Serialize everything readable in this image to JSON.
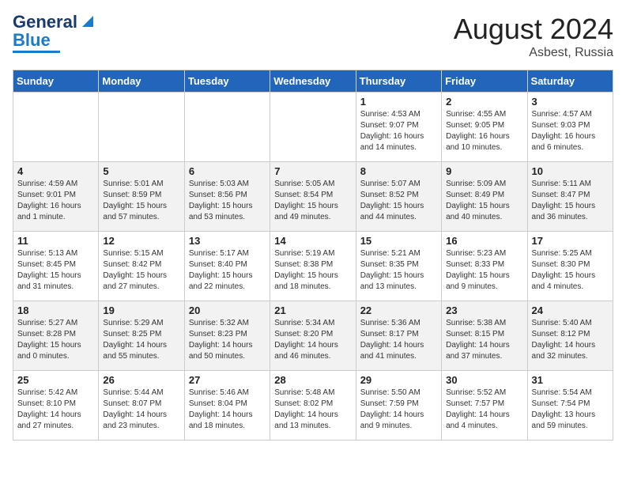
{
  "header": {
    "logo_line1": "General",
    "logo_line2": "Blue",
    "month_year": "August 2024",
    "location": "Asbest, Russia"
  },
  "days_of_week": [
    "Sunday",
    "Monday",
    "Tuesday",
    "Wednesday",
    "Thursday",
    "Friday",
    "Saturday"
  ],
  "weeks": [
    [
      {
        "day": "",
        "info": ""
      },
      {
        "day": "",
        "info": ""
      },
      {
        "day": "",
        "info": ""
      },
      {
        "day": "",
        "info": ""
      },
      {
        "day": "1",
        "info": "Sunrise: 4:53 AM\nSunset: 9:07 PM\nDaylight: 16 hours\nand 14 minutes."
      },
      {
        "day": "2",
        "info": "Sunrise: 4:55 AM\nSunset: 9:05 PM\nDaylight: 16 hours\nand 10 minutes."
      },
      {
        "day": "3",
        "info": "Sunrise: 4:57 AM\nSunset: 9:03 PM\nDaylight: 16 hours\nand 6 minutes."
      }
    ],
    [
      {
        "day": "4",
        "info": "Sunrise: 4:59 AM\nSunset: 9:01 PM\nDaylight: 16 hours\nand 1 minute."
      },
      {
        "day": "5",
        "info": "Sunrise: 5:01 AM\nSunset: 8:59 PM\nDaylight: 15 hours\nand 57 minutes."
      },
      {
        "day": "6",
        "info": "Sunrise: 5:03 AM\nSunset: 8:56 PM\nDaylight: 15 hours\nand 53 minutes."
      },
      {
        "day": "7",
        "info": "Sunrise: 5:05 AM\nSunset: 8:54 PM\nDaylight: 15 hours\nand 49 minutes."
      },
      {
        "day": "8",
        "info": "Sunrise: 5:07 AM\nSunset: 8:52 PM\nDaylight: 15 hours\nand 44 minutes."
      },
      {
        "day": "9",
        "info": "Sunrise: 5:09 AM\nSunset: 8:49 PM\nDaylight: 15 hours\nand 40 minutes."
      },
      {
        "day": "10",
        "info": "Sunrise: 5:11 AM\nSunset: 8:47 PM\nDaylight: 15 hours\nand 36 minutes."
      }
    ],
    [
      {
        "day": "11",
        "info": "Sunrise: 5:13 AM\nSunset: 8:45 PM\nDaylight: 15 hours\nand 31 minutes."
      },
      {
        "day": "12",
        "info": "Sunrise: 5:15 AM\nSunset: 8:42 PM\nDaylight: 15 hours\nand 27 minutes."
      },
      {
        "day": "13",
        "info": "Sunrise: 5:17 AM\nSunset: 8:40 PM\nDaylight: 15 hours\nand 22 minutes."
      },
      {
        "day": "14",
        "info": "Sunrise: 5:19 AM\nSunset: 8:38 PM\nDaylight: 15 hours\nand 18 minutes."
      },
      {
        "day": "15",
        "info": "Sunrise: 5:21 AM\nSunset: 8:35 PM\nDaylight: 15 hours\nand 13 minutes."
      },
      {
        "day": "16",
        "info": "Sunrise: 5:23 AM\nSunset: 8:33 PM\nDaylight: 15 hours\nand 9 minutes."
      },
      {
        "day": "17",
        "info": "Sunrise: 5:25 AM\nSunset: 8:30 PM\nDaylight: 15 hours\nand 4 minutes."
      }
    ],
    [
      {
        "day": "18",
        "info": "Sunrise: 5:27 AM\nSunset: 8:28 PM\nDaylight: 15 hours\nand 0 minutes."
      },
      {
        "day": "19",
        "info": "Sunrise: 5:29 AM\nSunset: 8:25 PM\nDaylight: 14 hours\nand 55 minutes."
      },
      {
        "day": "20",
        "info": "Sunrise: 5:32 AM\nSunset: 8:23 PM\nDaylight: 14 hours\nand 50 minutes."
      },
      {
        "day": "21",
        "info": "Sunrise: 5:34 AM\nSunset: 8:20 PM\nDaylight: 14 hours\nand 46 minutes."
      },
      {
        "day": "22",
        "info": "Sunrise: 5:36 AM\nSunset: 8:17 PM\nDaylight: 14 hours\nand 41 minutes."
      },
      {
        "day": "23",
        "info": "Sunrise: 5:38 AM\nSunset: 8:15 PM\nDaylight: 14 hours\nand 37 minutes."
      },
      {
        "day": "24",
        "info": "Sunrise: 5:40 AM\nSunset: 8:12 PM\nDaylight: 14 hours\nand 32 minutes."
      }
    ],
    [
      {
        "day": "25",
        "info": "Sunrise: 5:42 AM\nSunset: 8:10 PM\nDaylight: 14 hours\nand 27 minutes."
      },
      {
        "day": "26",
        "info": "Sunrise: 5:44 AM\nSunset: 8:07 PM\nDaylight: 14 hours\nand 23 minutes."
      },
      {
        "day": "27",
        "info": "Sunrise: 5:46 AM\nSunset: 8:04 PM\nDaylight: 14 hours\nand 18 minutes."
      },
      {
        "day": "28",
        "info": "Sunrise: 5:48 AM\nSunset: 8:02 PM\nDaylight: 14 hours\nand 13 minutes."
      },
      {
        "day": "29",
        "info": "Sunrise: 5:50 AM\nSunset: 7:59 PM\nDaylight: 14 hours\nand 9 minutes."
      },
      {
        "day": "30",
        "info": "Sunrise: 5:52 AM\nSunset: 7:57 PM\nDaylight: 14 hours\nand 4 minutes."
      },
      {
        "day": "31",
        "info": "Sunrise: 5:54 AM\nSunset: 7:54 PM\nDaylight: 13 hours\nand 59 minutes."
      }
    ]
  ]
}
